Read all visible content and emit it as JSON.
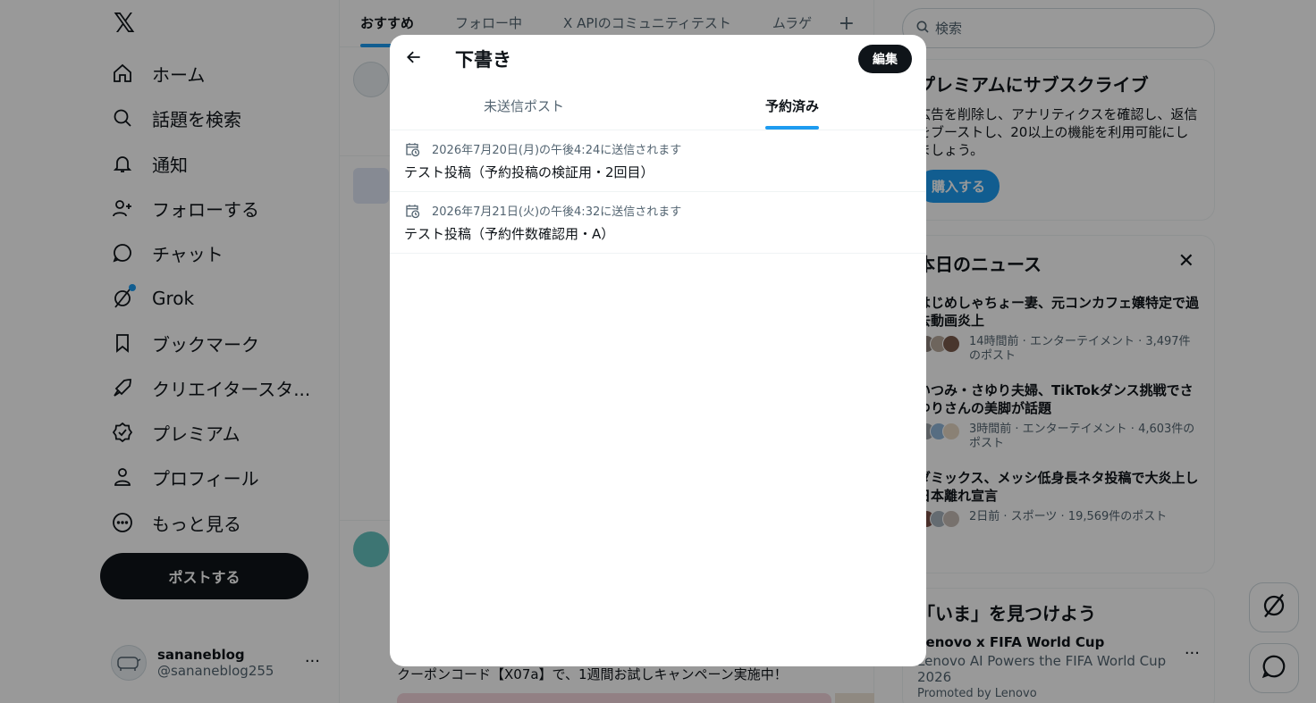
{
  "nav": {
    "items": [
      {
        "label": "ホーム",
        "icon": "home-icon"
      },
      {
        "label": "話題を検索",
        "icon": "search-icon"
      },
      {
        "label": "通知",
        "icon": "bell-icon"
      },
      {
        "label": "フォローする",
        "icon": "follow-icon"
      },
      {
        "label": "チャット",
        "icon": "chat-icon"
      },
      {
        "label": "Grok",
        "icon": "grok-icon"
      },
      {
        "label": "ブックマーク",
        "icon": "bookmark-icon"
      },
      {
        "label": "クリエイタースタ...",
        "icon": "rocket-icon"
      },
      {
        "label": "プレミアム",
        "icon": "verified-icon"
      },
      {
        "label": "プロフィール",
        "icon": "person-icon"
      },
      {
        "label": "もっと見る",
        "icon": "more-circle-icon"
      }
    ],
    "post_button": "ポストする",
    "account": {
      "name": "sananeblog",
      "handle": "@sananeblog255"
    }
  },
  "timeline": {
    "tabs": [
      "おすすめ",
      "フォロー中",
      "X APIのコミュニティテスト",
      "ムラゲ"
    ],
    "visible_text": "クーポンコード【X07a】で、1週間お試しキャンペーン実施中！"
  },
  "sidebar": {
    "search_placeholder": "検索",
    "premium": {
      "title": "プレミアムにサブスクライブ",
      "body": "広告を削除し、アナリティクスを確認し、返信をブーストし、20以上の機能を利用可能にしましょう。",
      "button": "購入する"
    },
    "news": {
      "title": "本日のニュース",
      "items": [
        {
          "title": "はじめしゃちょー妻、元コンカフェ嬢特定で過去動画炎上",
          "meta": "14時間前 · エンターテイメント · 3,497件のポスト"
        },
        {
          "title": "いつみ・さゆり夫婦、TikTokダンス挑戦でさゆりさんの美脚が話題",
          "meta": "3時間前 · エンターテイメント · 4,603件のポスト"
        },
        {
          "title": "ダミックス、メッシ低身長ネタ投稿で大炎上し日本離れ宣言",
          "meta": "2日前 · スポーツ · 19,569件のポスト"
        }
      ]
    },
    "discover": {
      "title": "「いま」を見つけよう",
      "promo_title": "Lenovo x FIFA World Cup",
      "promo_sub": "Lenovo AI Powers the FIFA World Cup 2026",
      "promo_by": "Promoted by Lenovo"
    }
  },
  "modal": {
    "title": "下書き",
    "edit_button": "編集",
    "tabs": [
      "未送信ポスト",
      "予約済み"
    ],
    "active_tab": "予約済み",
    "scheduled": [
      {
        "when": "2026年7月20日(月)の午後4:24に送信されます",
        "text": "テスト投稿（予約投稿の検証用・2回目）"
      },
      {
        "when": "2026年7月21日(火)の午後4:32に送信されます",
        "text": "テスト投稿（予約件数確認用・A）"
      }
    ]
  },
  "colors": {
    "accent": "#1d9bf0",
    "text": "#0f1419",
    "muted": "#536471",
    "overlay": "rgba(0,0,0,0.4)"
  }
}
